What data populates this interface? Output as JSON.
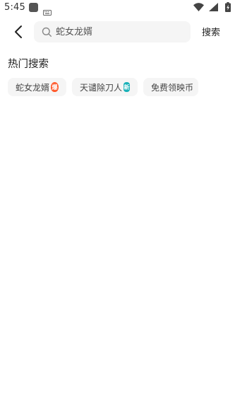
{
  "status_bar": {
    "time": "5:45",
    "icons": [
      "app-notification-icon",
      "keyboard-icon",
      "wifi-icon",
      "signal-icon",
      "battery-charging-icon"
    ]
  },
  "header": {
    "back_icon": "back-chevron-icon",
    "search": {
      "placeholder": "蛇女龙婿",
      "value": ""
    },
    "search_button_label": "搜索"
  },
  "hot_search": {
    "title": "热门搜索",
    "items": [
      {
        "label": "蛇女龙婿",
        "badge": "爆",
        "badge_type": "hot",
        "badge_color": "#ff5a2c"
      },
      {
        "label": "天谴除刀人",
        "badge": "新",
        "badge_type": "new",
        "badge_color": "#19b1b8"
      },
      {
        "label": "免费领映币",
        "badge": "",
        "badge_type": "none"
      }
    ]
  },
  "colors": {
    "background": "#ffffff",
    "chip_background": "#f5f5f5",
    "search_background": "#f5f5f5"
  }
}
